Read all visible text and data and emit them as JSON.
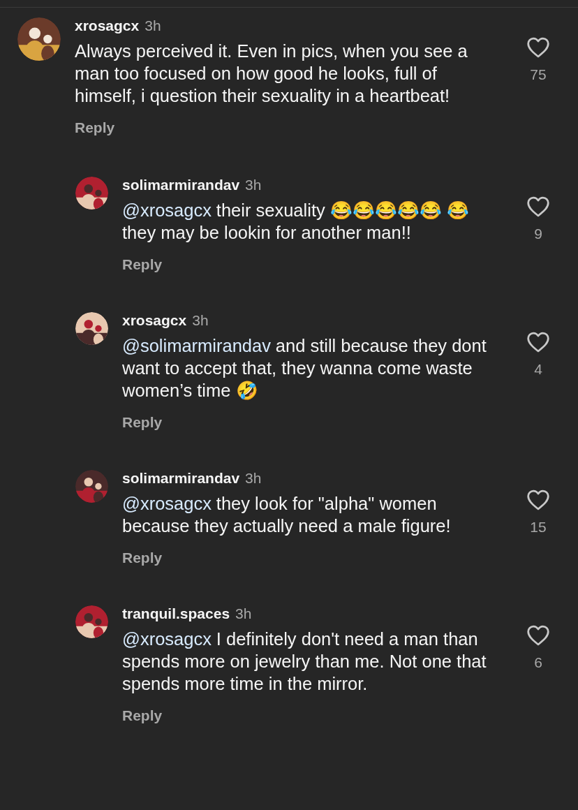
{
  "comments": [
    {
      "kind": "comment",
      "username": "xrosagcx",
      "time": "3h",
      "text": "Always perceived it. Even in pics, when you see a man too focused on how good he looks, full of himself, i question their sexuality in a heartbeat!",
      "likes": "75",
      "reply_label": "Reply"
    },
    {
      "kind": "reply",
      "username": "solimarmirandav",
      "time": "3h",
      "mention": "@xrosagcx",
      "text": "their sexuality 😂😂😂😂😂 😂 they may be lookin for another man!!",
      "likes": "9",
      "reply_label": "Reply"
    },
    {
      "kind": "reply",
      "username": "xrosagcx",
      "time": "3h",
      "mention": "@solimarmirandav",
      "text": "and still because they dont want to accept that, they wanna come waste women’s time 🤣",
      "likes": "4",
      "reply_label": "Reply"
    },
    {
      "kind": "reply",
      "username": "solimarmirandav",
      "time": "3h",
      "mention": "@xrosagcx",
      "text": "they look for \"alpha\" women because they actually need a male figure!",
      "likes": "15",
      "reply_label": "Reply"
    },
    {
      "kind": "reply",
      "username": "tranquil.spaces",
      "time": "3h",
      "mention": "@xrosagcx",
      "text": "I definitely don't need a man than spends more on jewelry than me. Not one that spends more time in the mirror.",
      "likes": "6",
      "reply_label": "Reply"
    }
  ]
}
